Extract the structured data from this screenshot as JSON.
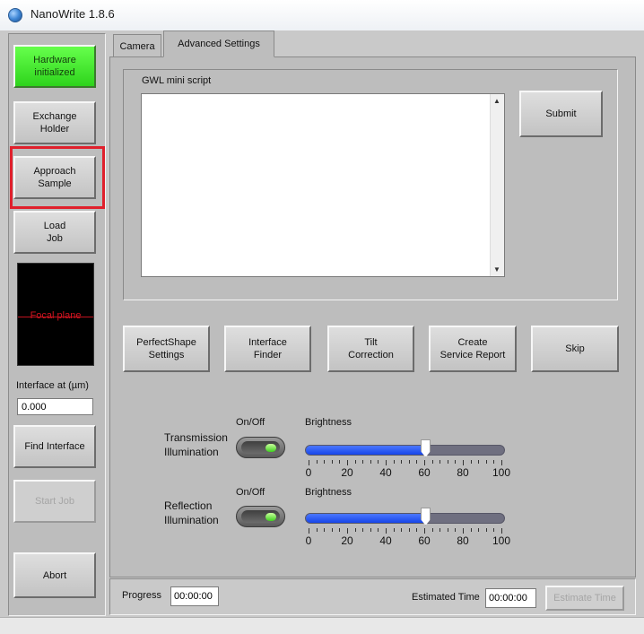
{
  "window": {
    "title": "NanoWrite 1.8.6"
  },
  "sidebar": {
    "hardware_status": "Hardware\ninitialized",
    "exchange_holder": "Exchange\nHolder",
    "approach_sample": "Approach\nSample",
    "load_job": "Load\nJob",
    "focal_plane_label": "Focal plane",
    "interface_label": "Interface at (µm)",
    "interface_value": "0.000",
    "find_interface": "Find Interface",
    "start_job": "Start Job",
    "abort": "Abort"
  },
  "tabs": [
    {
      "label": "Camera",
      "active": false
    },
    {
      "label": "Advanced Settings",
      "active": true
    }
  ],
  "gwl": {
    "label": "GWL mini script",
    "script_text": "",
    "submit": "Submit"
  },
  "actions": {
    "perfectshape": "PerfectShape\nSettings",
    "interface_finder": "Interface\nFinder",
    "tilt_correction": "Tilt\nCorrection",
    "service_report": "Create\nService Report",
    "skip": "Skip"
  },
  "illumination": {
    "transmission": {
      "label": "Transmission\nIllumination",
      "on_off_label": "On/Off",
      "brightness_label": "Brightness",
      "brightness": 60,
      "on": true
    },
    "reflection": {
      "label": "Reflection\nIllumination",
      "on_off_label": "On/Off",
      "brightness_label": "Brightness",
      "brightness": 60,
      "on": true
    },
    "scale": {
      "min": 0,
      "max": 100,
      "labels": [
        "0",
        "20",
        "40",
        "60",
        "80",
        "100"
      ]
    }
  },
  "status": {
    "progress_label": "Progress",
    "progress_value": "00:00:00",
    "estimated_label": "Estimated Time",
    "estimated_value": "00:00:00",
    "estimate_button": "Estimate Time"
  },
  "colors": {
    "hardware_ok": "#3fe02a",
    "highlight": "#e0202c",
    "slider_fill": "#1f4ff0",
    "focal_line": "#c0121f"
  },
  "icons": {
    "app": "globe-icon",
    "scroll_up": "scroll-up-icon",
    "scroll_down": "scroll-down-icon"
  }
}
